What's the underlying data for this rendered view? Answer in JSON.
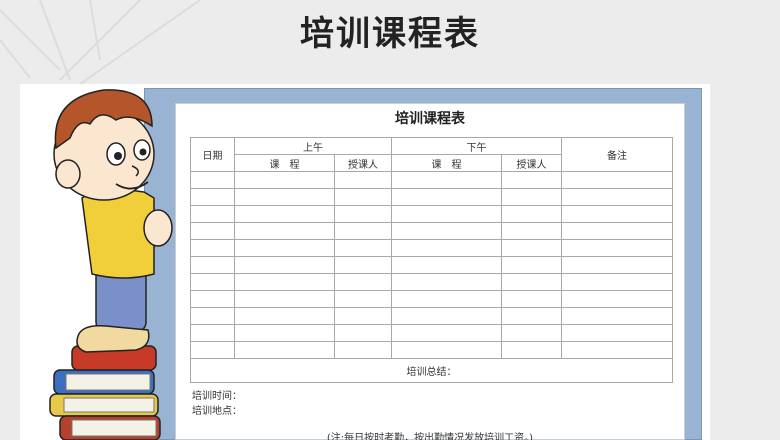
{
  "page": {
    "title": "培训课程表"
  },
  "sheet": {
    "title": "培训课程表",
    "headers": {
      "date": "日期",
      "morning": "上午",
      "afternoon": "下午",
      "remarks": "备注",
      "course": "课　程",
      "instructor": "授课人"
    },
    "blank_rows": 11,
    "summary_label": "培训总结：",
    "time_label": "培训时间：",
    "location_label": "培训地点：",
    "note": "(注:每日按时考勤，按出勤情况发放培训工资。)"
  },
  "colors": {
    "frame_blue": "#99b4d3",
    "background": "#ececec",
    "grid": "#a8a8a8"
  },
  "icons": [
    "boy-on-books-illustration"
  ]
}
